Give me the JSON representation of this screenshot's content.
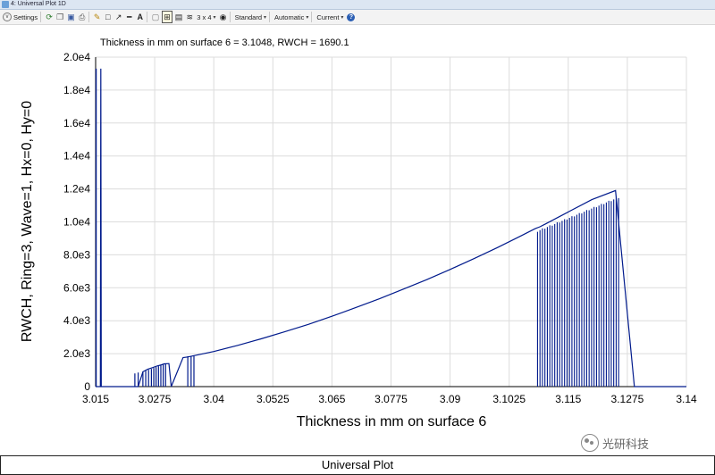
{
  "window": {
    "title": "4: Universal Plot 1D"
  },
  "toolbar": {
    "settings_label": "Settings",
    "layout_label": "3 x 4",
    "standard_label": "Standard",
    "automatic_label": "Automatic",
    "current_label": "Current",
    "help_label": "?"
  },
  "plot": {
    "header": "Thickness in mm on surface 6 = 3.1048, RWCH = 1690.1"
  },
  "chart_data": {
    "type": "line",
    "xlabel": "Thickness in mm on surface 6",
    "ylabel": "RWCH, Ring=3, Wave=1, Hx=0, Hy=0",
    "xlim": [
      3.015,
      3.14
    ],
    "ylim": [
      0,
      20000
    ],
    "xticks": [
      "3.015",
      "3.0275",
      "3.04",
      "3.0525",
      "3.065",
      "3.0775",
      "3.09",
      "3.1025",
      "3.115",
      "3.1275",
      "3.14"
    ],
    "yticks": [
      "0",
      "2.0e3",
      "4.0e3",
      "6.0e3",
      "8.0e3",
      "1.0e4",
      "1.2e4",
      "1.4e4",
      "1.6e4",
      "1.8e4",
      "2.0e4"
    ],
    "grid": true,
    "line_color": "#001a8c",
    "series": [
      {
        "x": [
          3.015,
          3.016,
          3.0161,
          3.0162,
          3.018,
          3.019,
          3.02,
          3.022,
          3.024,
          3.025,
          3.026,
          3.027,
          3.028,
          3.029,
          3.0295,
          3.0305,
          3.031,
          3.0335,
          3.0345,
          3.0355,
          3.04,
          3.045,
          3.05,
          3.055,
          3.06,
          3.065,
          3.07,
          3.075,
          3.08,
          3.085,
          3.09,
          3.095,
          3.1,
          3.105,
          3.108,
          3.109,
          3.11,
          3.115,
          3.12,
          3.125,
          3.129,
          3.13,
          3.135,
          3.14
        ],
        "y": [
          0,
          0,
          19300,
          0,
          0,
          0,
          0,
          0,
          0,
          900,
          1050,
          1150,
          1250,
          1330,
          1380,
          1400,
          0,
          1760,
          1800,
          1860,
          2130,
          2500,
          2900,
          3330,
          3780,
          4270,
          4790,
          5330,
          5900,
          6490,
          7110,
          7760,
          8440,
          9150,
          9590,
          9700,
          9850,
          10600,
          11350,
          11900,
          0,
          0,
          0,
          0
        ]
      }
    ]
  },
  "footer": {
    "label": "Universal Plot"
  },
  "watermark": {
    "text": "光研科技"
  }
}
